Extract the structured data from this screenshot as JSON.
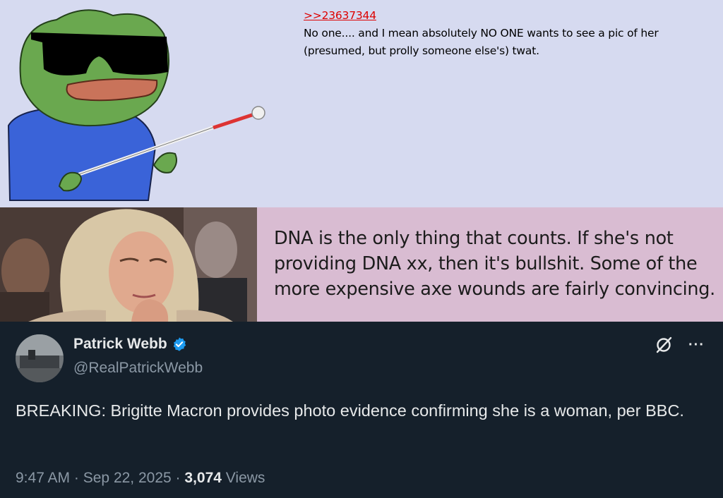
{
  "post": {
    "quote_link": ">>23637344",
    "body": "No one.... and I mean absolutely NO ONE wants to see a pic of her (presumed, but prolly someone else's) twat."
  },
  "strip": {
    "caption": "DNA is the only thing that counts. If she's not providing DNA xx, then it's bullshit.  Some of the more expensive axe wounds are fairly convincing."
  },
  "tweet": {
    "display_name": "Patrick Webb",
    "handle": "@RealPatrickWebb",
    "text": "BREAKING: Brigitte Macron provides photo evidence confirming she is a woman, per BBC.",
    "time": "9:47 AM",
    "separator": "·",
    "date": "Sep 22, 2025",
    "views_count": "3,074",
    "views_label": "Views",
    "more_label": "···",
    "colors": {
      "background": "#15202b",
      "verified": "#1d9bf0",
      "secondary": "#8b98a5"
    },
    "icons": [
      "verified-badge-icon",
      "grok-icon",
      "more-icon"
    ]
  }
}
